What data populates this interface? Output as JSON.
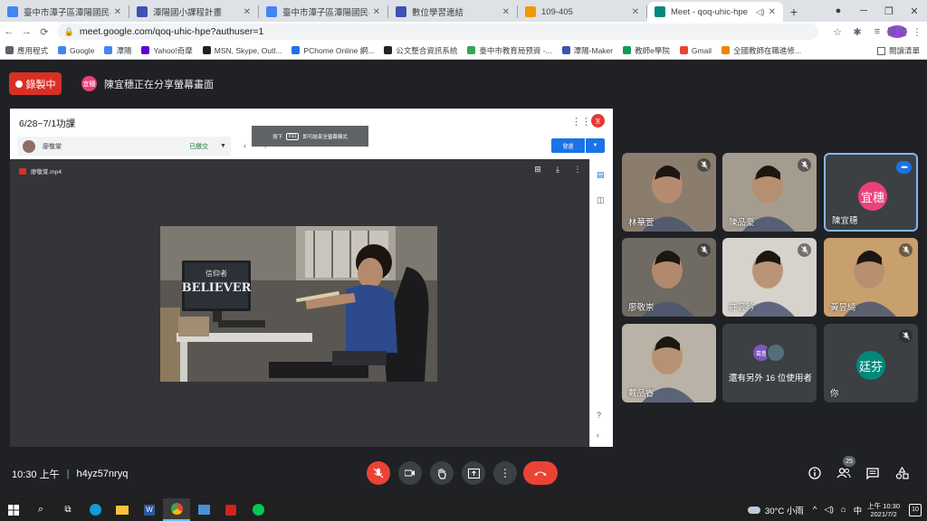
{
  "browser": {
    "tabs": [
      {
        "title": "臺中市潭子區潭陽國民小學",
        "color": "#4285f4",
        "active": false
      },
      {
        "title": "潭陽國小課程計畫",
        "color": "#3f51b5",
        "active": false
      },
      {
        "title": "臺中市潭子區潭陽國民小學",
        "color": "#4285f4",
        "active": false
      },
      {
        "title": "數位學習連結",
        "color": "#3f51b5",
        "active": false
      },
      {
        "title": "109-405",
        "color": "#f29900",
        "active": false
      },
      {
        "title": "Meet - qoq-uhic-hpe",
        "color": "#00897b",
        "active": true
      }
    ],
    "url": "meet.google.com/qoq-uhic-hpe?authuser=1",
    "profile_initials": "陳宜",
    "bookmarks": [
      {
        "label": "應用程式",
        "color": "#5f6368"
      },
      {
        "label": "Google",
        "color": "#4285f4"
      },
      {
        "label": "潭陽",
        "color": "#4285f4"
      },
      {
        "label": "Yahoo!奇摩",
        "color": "#6001d2"
      },
      {
        "label": "MSN, Skype, Outl...",
        "color": "#202124"
      },
      {
        "label": "PChome Online 網...",
        "color": "#1a73e8"
      },
      {
        "label": "公文整合資訊系統",
        "color": "#202124"
      },
      {
        "label": "臺中市教育局预資 -...",
        "color": "#34a853"
      },
      {
        "label": "潭陽-Maker",
        "color": "#3f51b5"
      },
      {
        "label": "教師e學院",
        "color": "#0f9d58"
      },
      {
        "label": "Gmail",
        "color": "#ea4335"
      },
      {
        "label": "全國教師在職進修...",
        "color": "#ea8600"
      }
    ],
    "reading_list": "閱讀清單"
  },
  "meet": {
    "recording_label": "錄製中",
    "presenter_initials": "宜穗",
    "presenter_text": "陳宜穗正在分享螢幕畫面",
    "share": {
      "assignment_title": "6/28~7/1功課",
      "student_name": "廖敬棠",
      "submission_status": "已繳交",
      "f11_text_before": "按下",
      "f11_key": "F11",
      "f11_text_after": "即可結束全螢幕模式",
      "return_button": "發還",
      "file_name": "廖敬棠.mp4",
      "video_screen_text_1": "信仰者",
      "video_screen_text_2": "BELIEVER"
    },
    "participants": [
      {
        "name": "林華萱",
        "muted": true,
        "type": "video",
        "bg": "#8a7d6e"
      },
      {
        "name": "陳品豪",
        "muted": true,
        "type": "video",
        "bg": "#a59c90"
      },
      {
        "name": "陳宜穗",
        "muted": false,
        "type": "avatar",
        "initials": "宜穗",
        "color": "#ec407a",
        "active": true
      },
      {
        "name": "廖敬崇",
        "muted": true,
        "type": "video",
        "bg": "#6f6b62"
      },
      {
        "name": "許芸吟",
        "muted": true,
        "type": "video",
        "bg": "#d8d2cc"
      },
      {
        "name": "黃昱綺",
        "muted": true,
        "type": "video",
        "bg": "#c7a06d"
      },
      {
        "name": "戴品睿",
        "muted": false,
        "type": "video",
        "bg": "#b9b2a6"
      },
      {
        "name": "還有另外 16 位使用者",
        "muted": false,
        "type": "more",
        "avatars": [
          "葛萱",
          ""
        ]
      },
      {
        "name": "你",
        "muted": true,
        "type": "avatar",
        "initials": "廷芬",
        "color": "#00897b"
      }
    ],
    "time": "10:30 上午",
    "meeting_code": "h4yz57nryq",
    "people_count": "25"
  },
  "taskbar": {
    "weather": "30°C 小雨",
    "ime": "中",
    "time": "上午 10:30",
    "date": "2021/7/2",
    "notifications": "10"
  }
}
